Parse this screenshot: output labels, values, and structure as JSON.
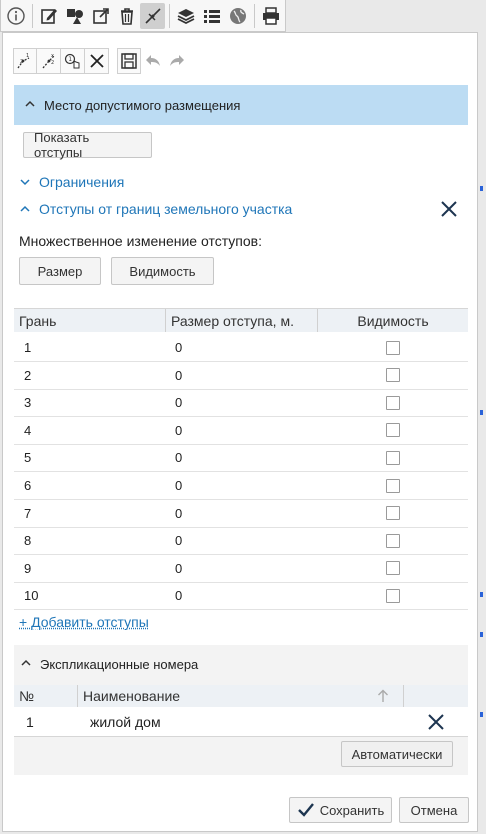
{
  "colors": {
    "accent_link": "#1f76b8",
    "section_header_bg": "#bcdcf3",
    "map_edge": "#2a62d8"
  },
  "top_toolbar": {
    "icons": [
      "info-icon",
      "edit-icon",
      "shapes-icon",
      "export-icon",
      "trash-icon",
      "measure-icon",
      "layers-icon",
      "list-icon",
      "globe-icon",
      "print-icon"
    ],
    "active": "measure-icon"
  },
  "edit_toolbar": {
    "icons": [
      "vertex-edit-icon",
      "vertex-move-icon",
      "pointer-number-icon",
      "close-icon",
      "save-icon",
      "undo-icon",
      "redo-icon"
    ]
  },
  "section": {
    "title": "Место допустимого размещения",
    "show_indents_button": "Показать отступы"
  },
  "restrictions": {
    "label": "Ограничения"
  },
  "indents": {
    "title": "Отступы от границ земельного участка",
    "bulk_label": "Множественное изменение отступов:",
    "size_button": "Размер",
    "visibility_button": "Видимость",
    "columns": [
      "Грань",
      "Размер отступа, м.",
      "Видимость"
    ],
    "rows": [
      {
        "edge": "1",
        "size": "0",
        "visible": false
      },
      {
        "edge": "2",
        "size": "0",
        "visible": false
      },
      {
        "edge": "3",
        "size": "0",
        "visible": false
      },
      {
        "edge": "4",
        "size": "0",
        "visible": false
      },
      {
        "edge": "5",
        "size": "0",
        "visible": false
      },
      {
        "edge": "6",
        "size": "0",
        "visible": false
      },
      {
        "edge": "7",
        "size": "0",
        "visible": false
      },
      {
        "edge": "8",
        "size": "0",
        "visible": false
      },
      {
        "edge": "9",
        "size": "0",
        "visible": false
      },
      {
        "edge": "10",
        "size": "0",
        "visible": false
      }
    ],
    "add_link": "+ Добавить отступы"
  },
  "explication": {
    "title": "Экспликационные номера",
    "columns": [
      "№",
      "Наименование"
    ],
    "rows": [
      {
        "num": "1",
        "name": "жилой дом"
      }
    ],
    "auto_button": "Автоматически"
  },
  "footer": {
    "save_button": "Сохранить",
    "cancel_button": "Отмена"
  }
}
